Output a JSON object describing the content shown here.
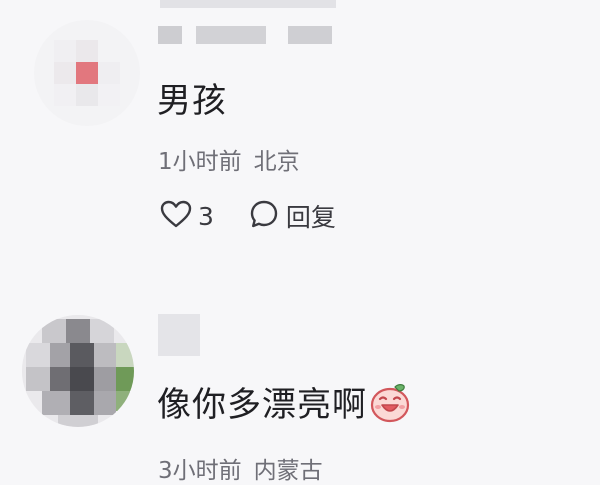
{
  "comments": [
    {
      "text": "男孩",
      "time": "1小时前",
      "location": "北京",
      "likes": "3",
      "reply_label": "回复"
    },
    {
      "text": "像你多漂亮啊",
      "time": "3小时前",
      "location": "内蒙古",
      "sticker": "laughing-face-emoji"
    }
  ],
  "colors": {
    "background": "#f7f7f9",
    "text": "#1f1f23",
    "meta": "#6f6f77",
    "avatar_accent": "#e7757c"
  }
}
